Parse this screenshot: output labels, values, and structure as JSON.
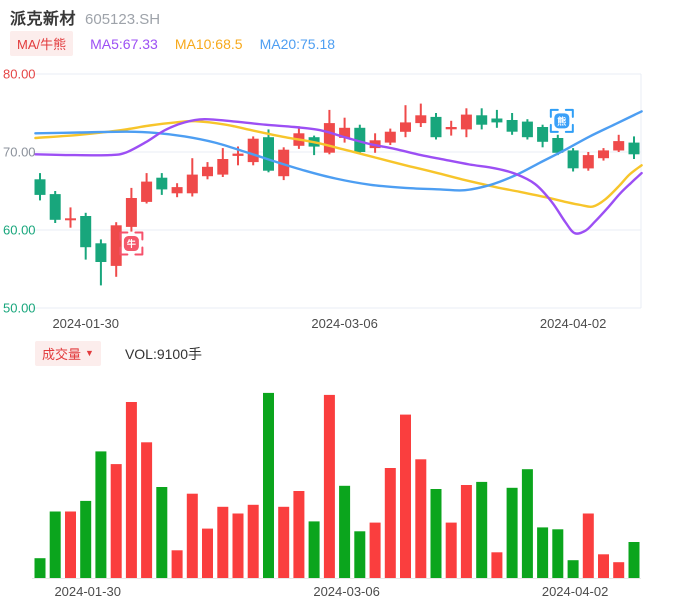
{
  "header": {
    "title": "派克新材",
    "code": "605123.SH",
    "ma_badge": "MA/牛熊",
    "ma5": "MA5:67.33",
    "ma10": "MA10:68.5",
    "ma20": "MA20:75.18"
  },
  "volume_header": {
    "badge_label": "成交量",
    "caret": "▼",
    "vol_label": "VOL:9100手"
  },
  "colors": {
    "candle_up": "#ef4a4a",
    "candle_down": "#18a67c",
    "vol_up": "#fa3e3e",
    "vol_down": "#0ba51d",
    "ma5": "#9c4ff4",
    "ma10": "#f7c52b",
    "ma20": "#4d9ef2",
    "tick_red": "#e54545",
    "tick_gray": "#8b919b",
    "tick_green": "#18a67c",
    "badge_bg": "#fcedec",
    "badge_text": "#e23b3d",
    "grid": "#e9edf4",
    "vol_baseline": "#e8e8e8",
    "bull_marker": "#f4586b",
    "bull_bracket": "#f6516b",
    "bear_marker": "#3ba0f8",
    "bear_bracket": "#2f9ef6"
  },
  "chart_data": [
    {
      "type": "candlestick",
      "title": "K线主图",
      "ylim": [
        50,
        80
      ],
      "y_ticks": [
        {
          "label": "80.00",
          "value": 80,
          "color": "#e54545"
        },
        {
          "label": "70.00",
          "value": 70,
          "color": "#8b919b"
        },
        {
          "label": "60.00",
          "value": 60,
          "color": "#18a67c"
        },
        {
          "label": "50.00",
          "value": 50,
          "color": "#18a67c"
        }
      ],
      "x_ticks": [
        {
          "label": "2024-01-30",
          "candle": 4
        },
        {
          "label": "2024-03-06",
          "candle": 21
        },
        {
          "label": "2024-04-02",
          "candle": 36
        }
      ],
      "candles": [
        {
          "o": 66.5,
          "h": 67.3,
          "l": 63.8,
          "c": 64.5,
          "dir": "down"
        },
        {
          "o": 64.6,
          "h": 65.0,
          "l": 60.9,
          "c": 61.3,
          "dir": "down"
        },
        {
          "o": 61.3,
          "h": 62.9,
          "l": 60.3,
          "c": 61.5,
          "dir": "up"
        },
        {
          "o": 61.8,
          "h": 62.2,
          "l": 56.2,
          "c": 57.8,
          "dir": "down"
        },
        {
          "o": 58.3,
          "h": 58.8,
          "l": 52.9,
          "c": 55.9,
          "dir": "down"
        },
        {
          "o": 55.4,
          "h": 61.0,
          "l": 54.0,
          "c": 60.6,
          "dir": "up"
        },
        {
          "o": 60.4,
          "h": 65.4,
          "l": 59.8,
          "c": 64.1,
          "dir": "up"
        },
        {
          "o": 63.6,
          "h": 67.3,
          "l": 63.4,
          "c": 66.2,
          "dir": "up"
        },
        {
          "o": 66.7,
          "h": 67.3,
          "l": 64.5,
          "c": 65.2,
          "dir": "down"
        },
        {
          "o": 64.7,
          "h": 66.0,
          "l": 64.2,
          "c": 65.5,
          "dir": "up"
        },
        {
          "o": 64.7,
          "h": 69.2,
          "l": 64.3,
          "c": 67.1,
          "dir": "up"
        },
        {
          "o": 66.9,
          "h": 68.7,
          "l": 66.5,
          "c": 68.1,
          "dir": "up"
        },
        {
          "o": 67.1,
          "h": 70.5,
          "l": 66.8,
          "c": 69.1,
          "dir": "up"
        },
        {
          "o": 69.5,
          "h": 70.7,
          "l": 68.3,
          "c": 69.8,
          "dir": "up"
        },
        {
          "o": 68.7,
          "h": 72.0,
          "l": 68.3,
          "c": 71.7,
          "dir": "up"
        },
        {
          "o": 71.9,
          "h": 72.9,
          "l": 67.4,
          "c": 67.6,
          "dir": "down"
        },
        {
          "o": 66.9,
          "h": 70.6,
          "l": 66.4,
          "c": 70.3,
          "dir": "up"
        },
        {
          "o": 70.8,
          "h": 73.3,
          "l": 70.4,
          "c": 72.4,
          "dir": "up"
        },
        {
          "o": 71.9,
          "h": 72.1,
          "l": 69.6,
          "c": 70.7,
          "dir": "down"
        },
        {
          "o": 69.9,
          "h": 75.4,
          "l": 69.7,
          "c": 73.7,
          "dir": "up"
        },
        {
          "o": 71.8,
          "h": 74.4,
          "l": 71.2,
          "c": 73.1,
          "dir": "up"
        },
        {
          "o": 73.1,
          "h": 73.5,
          "l": 69.8,
          "c": 70.0,
          "dir": "down"
        },
        {
          "o": 70.5,
          "h": 72.4,
          "l": 69.9,
          "c": 71.5,
          "dir": "up"
        },
        {
          "o": 71.2,
          "h": 73.0,
          "l": 70.9,
          "c": 72.6,
          "dir": "up"
        },
        {
          "o": 72.6,
          "h": 76.0,
          "l": 71.9,
          "c": 73.8,
          "dir": "up"
        },
        {
          "o": 73.7,
          "h": 76.2,
          "l": 73.2,
          "c": 74.7,
          "dir": "up"
        },
        {
          "o": 74.5,
          "h": 75.0,
          "l": 71.6,
          "c": 71.9,
          "dir": "down"
        },
        {
          "o": 72.9,
          "h": 74.0,
          "l": 72.1,
          "c": 73.2,
          "dir": "up"
        },
        {
          "o": 72.9,
          "h": 75.6,
          "l": 71.9,
          "c": 74.8,
          "dir": "up"
        },
        {
          "o": 74.7,
          "h": 75.6,
          "l": 72.9,
          "c": 73.5,
          "dir": "down"
        },
        {
          "o": 74.3,
          "h": 75.4,
          "l": 73.1,
          "c": 73.8,
          "dir": "down"
        },
        {
          "o": 74.1,
          "h": 75.0,
          "l": 72.2,
          "c": 72.6,
          "dir": "down"
        },
        {
          "o": 73.9,
          "h": 74.2,
          "l": 71.6,
          "c": 71.9,
          "dir": "down"
        },
        {
          "o": 73.2,
          "h": 73.5,
          "l": 70.6,
          "c": 71.3,
          "dir": "down"
        },
        {
          "o": 71.8,
          "h": 72.2,
          "l": 69.6,
          "c": 69.9,
          "dir": "down"
        },
        {
          "o": 70.2,
          "h": 70.5,
          "l": 67.5,
          "c": 67.9,
          "dir": "down"
        },
        {
          "o": 67.9,
          "h": 70.0,
          "l": 67.6,
          "c": 69.6,
          "dir": "up"
        },
        {
          "o": 69.2,
          "h": 70.5,
          "l": 68.9,
          "c": 70.2,
          "dir": "up"
        },
        {
          "o": 70.2,
          "h": 72.2,
          "l": 70.0,
          "c": 71.4,
          "dir": "up"
        },
        {
          "o": 71.2,
          "h": 72.0,
          "l": 69.1,
          "c": 69.7,
          "dir": "down"
        }
      ],
      "ma_lines": [
        {
          "name": "MA5",
          "value": 67.33,
          "color": "#9c4ff4",
          "points": [
            [
              0.7,
              69.7
            ],
            [
              3.3,
              69.6
            ],
            [
              5.6,
              69.6
            ],
            [
              6.6,
              69.9
            ],
            [
              7.9,
              71.2
            ],
            [
              9.2,
              72.8
            ],
            [
              10.5,
              73.8
            ],
            [
              11.8,
              74.2
            ],
            [
              13.8,
              73.9
            ],
            [
              15.8,
              73.5
            ],
            [
              17.7,
              73.2
            ],
            [
              19.4,
              72.8
            ],
            [
              21.0,
              71.9
            ],
            [
              22.7,
              71.0
            ],
            [
              24.3,
              70.4
            ],
            [
              26.0,
              69.6
            ],
            [
              27.6,
              69.0
            ],
            [
              29.2,
              68.4
            ],
            [
              30.9,
              67.9
            ],
            [
              32.2,
              67.2
            ],
            [
              33.5,
              65.9
            ],
            [
              34.6,
              63.6
            ],
            [
              35.5,
              61.0
            ],
            [
              36.1,
              59.6
            ],
            [
              36.8,
              59.9
            ],
            [
              37.4,
              61.0
            ],
            [
              38.3,
              62.9
            ],
            [
              39.1,
              64.7
            ],
            [
              39.9,
              66.2
            ],
            [
              40.5,
              67.3
            ]
          ]
        },
        {
          "name": "MA10",
          "value": 68.5,
          "color": "#f7c52b",
          "points": [
            [
              0.7,
              71.8
            ],
            [
              3.6,
              72.2
            ],
            [
              6.3,
              72.8
            ],
            [
              8.2,
              73.4
            ],
            [
              9.9,
              73.8
            ],
            [
              11.2,
              73.95
            ],
            [
              13.2,
              73.5
            ],
            [
              15.1,
              72.7
            ],
            [
              17.1,
              71.9
            ],
            [
              19.1,
              71.2
            ],
            [
              21.0,
              70.3
            ],
            [
              23.0,
              69.3
            ],
            [
              25.0,
              68.3
            ],
            [
              26.9,
              67.4
            ],
            [
              28.9,
              66.4
            ],
            [
              30.9,
              65.5
            ],
            [
              32.5,
              64.9
            ],
            [
              34.2,
              64.2
            ],
            [
              35.5,
              63.6
            ],
            [
              36.5,
              63.2
            ],
            [
              37.3,
              63.0
            ],
            [
              38.1,
              63.9
            ],
            [
              39.0,
              65.6
            ],
            [
              39.7,
              67.1
            ],
            [
              40.5,
              68.3
            ]
          ]
        },
        {
          "name": "MA20",
          "value": 75.18,
          "color": "#4d9ef2",
          "points": [
            [
              0.7,
              72.4
            ],
            [
              3.6,
              72.5
            ],
            [
              6.6,
              72.6
            ],
            [
              8.6,
              72.45
            ],
            [
              10.5,
              72.0
            ],
            [
              12.5,
              71.2
            ],
            [
              14.5,
              70.0
            ],
            [
              16.4,
              68.8
            ],
            [
              18.4,
              67.6
            ],
            [
              20.4,
              66.6
            ],
            [
              22.7,
              65.8
            ],
            [
              25.0,
              65.4
            ],
            [
              27.3,
              65.2
            ],
            [
              28.9,
              65.1
            ],
            [
              30.6,
              65.8
            ],
            [
              32.2,
              67.0
            ],
            [
              33.8,
              68.6
            ],
            [
              35.5,
              70.3
            ],
            [
              37.1,
              72.0
            ],
            [
              38.8,
              73.6
            ],
            [
              40.5,
              75.2
            ]
          ]
        }
      ],
      "markers": [
        {
          "type": "bull",
          "glyph": "牛",
          "candle": 7,
          "position": "below"
        },
        {
          "type": "bear",
          "glyph": "熊",
          "candle": 35,
          "position": "above"
        }
      ]
    },
    {
      "type": "bar",
      "name": "成交量",
      "unit": "手",
      "current_value": 9100,
      "values": [
        5000,
        16800,
        16800,
        19500,
        32000,
        28800,
        44500,
        34300,
        23000,
        7000,
        21300,
        12500,
        18000,
        16300,
        18500,
        46800,
        18000,
        22000,
        14300,
        46300,
        23300,
        11800,
        14000,
        27800,
        41300,
        30000,
        22500,
        14000,
        23500,
        24300,
        6500,
        22800,
        27500,
        12800,
        12300,
        4500,
        16300,
        6000,
        4000,
        9100
      ],
      "directions": [
        "down",
        "down",
        "up",
        "down",
        "down",
        "up",
        "up",
        "up",
        "down",
        "up",
        "up",
        "up",
        "up",
        "up",
        "up",
        "down",
        "up",
        "up",
        "down",
        "up",
        "down",
        "down",
        "up",
        "up",
        "up",
        "up",
        "down",
        "up",
        "up",
        "down",
        "up",
        "down",
        "down",
        "down",
        "down",
        "down",
        "up",
        "up",
        "up",
        "down"
      ],
      "x_ticks": [
        {
          "label": "2024-01-30",
          "bar": 4
        },
        {
          "label": "2024-03-06",
          "bar": 21
        },
        {
          "label": "2024-04-02",
          "bar": 36
        }
      ]
    }
  ]
}
